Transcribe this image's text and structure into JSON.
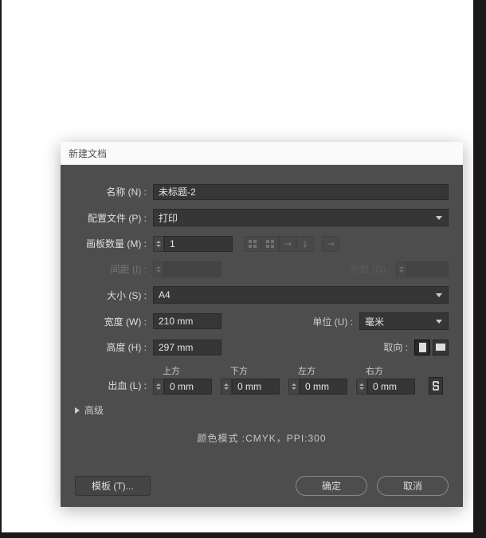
{
  "dialog": {
    "title": "新建文档",
    "name_label": "名称 (N) :",
    "name_value": "未标题-2",
    "profile_label": "配置文件 (P) :",
    "profile_value": "打印",
    "artboards_label": "画板数量 (M) :",
    "artboards_value": "1",
    "spacing_label": "间距 (I) :",
    "spacing_value": "",
    "cols_label": "列数 (O) :",
    "cols_value": "",
    "size_label": "大小 (S) :",
    "size_value": "A4",
    "width_label": "宽度 (W) :",
    "width_value": "210 mm",
    "units_label": "单位 (U) :",
    "units_value": "毫米",
    "height_label": "高度 (H) :",
    "height_value": "297 mm",
    "orient_label": "取向 :",
    "bleed_label": "出血 (L) :",
    "bleed_top": "上方",
    "bleed_bottom": "下方",
    "bleed_left": "左方",
    "bleed_right": "右方",
    "bleed_val": "0 mm",
    "advanced": "高级",
    "mode_info": "颜色模式 :CMYK，PPI:300",
    "template_btn": "模板 (T)...",
    "ok_btn": "确定",
    "cancel_btn": "取消"
  }
}
